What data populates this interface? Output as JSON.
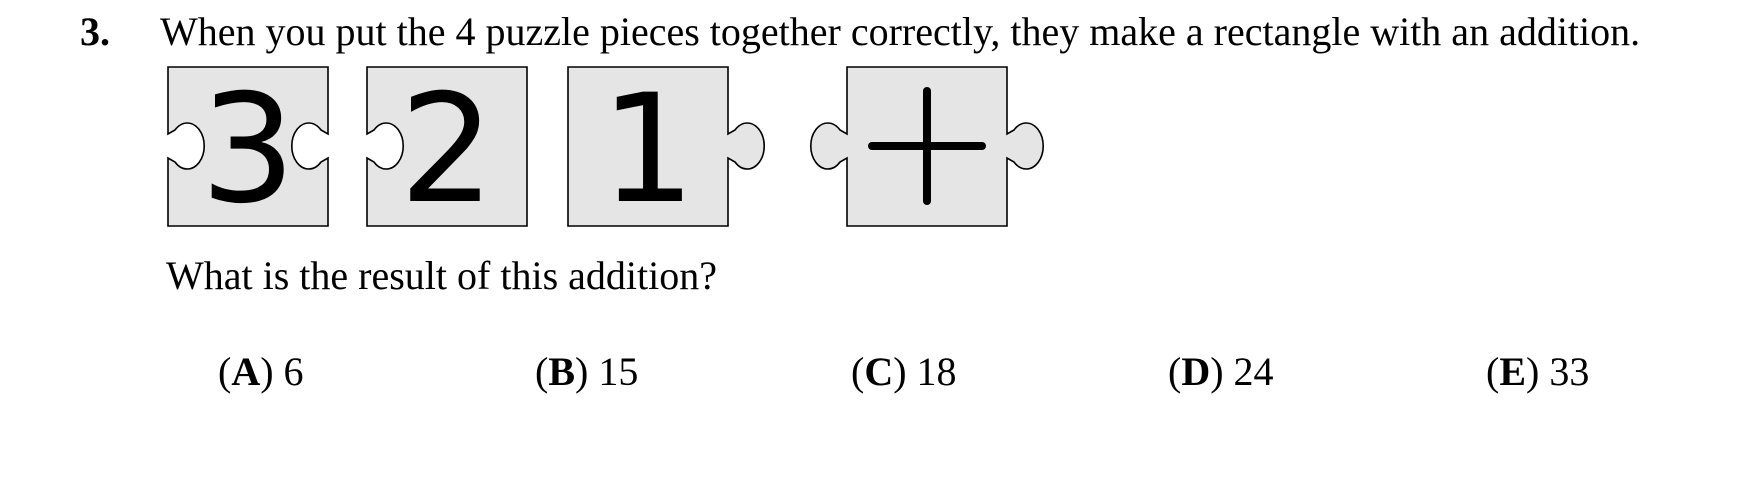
{
  "question": {
    "number": "3.",
    "text": "When you put the 4 puzzle pieces together correctly, they make a rectangle with an addition.",
    "prompt": "What is the result of this addition?"
  },
  "pieces": [
    {
      "symbol": "3",
      "left": "hole",
      "right": "hole"
    },
    {
      "symbol": "2",
      "left": "hole",
      "right": "flat"
    },
    {
      "symbol": "1",
      "left": "flat",
      "right": "tab"
    },
    {
      "symbol": "+",
      "left": "tab",
      "right": "tab"
    }
  ],
  "options": [
    {
      "letter": "A",
      "value": "6"
    },
    {
      "letter": "B",
      "value": "15"
    },
    {
      "letter": "C",
      "value": "18"
    },
    {
      "letter": "D",
      "value": "24"
    },
    {
      "letter": "E",
      "value": "33"
    }
  ],
  "colors": {
    "piece_fill": "#e5e5e5",
    "stroke": "#000000"
  }
}
